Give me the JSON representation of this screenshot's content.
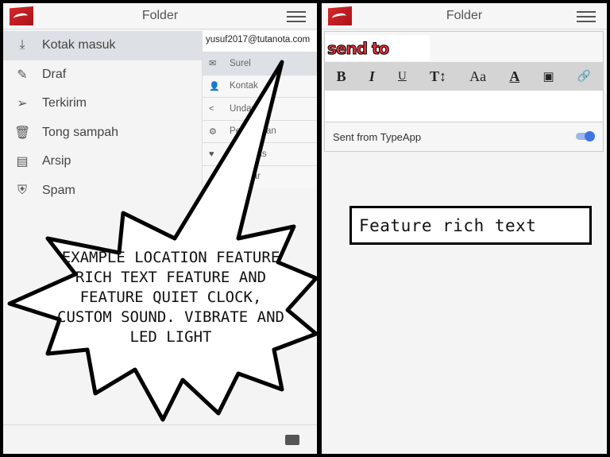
{
  "left": {
    "title": "Folder",
    "nav": [
      {
        "label": "Kotak masuk",
        "icon": "inbox-icon",
        "glyph": "⤓",
        "active": true
      },
      {
        "label": "Draf",
        "icon": "edit-icon",
        "glyph": "✎"
      },
      {
        "label": "Terkirim",
        "icon": "send-icon",
        "glyph": "➢"
      },
      {
        "label": "Tong sampah",
        "icon": "trash-icon",
        "glyph": "🗑"
      },
      {
        "label": "Arsip",
        "icon": "archive-icon",
        "glyph": "▤"
      },
      {
        "label": "Spam",
        "icon": "shield-icon",
        "glyph": "⛨"
      }
    ],
    "drawer": {
      "account": "yusuf2017@tutanota.com",
      "items": [
        {
          "label": "Surel",
          "icon": "mail-icon",
          "glyph": "✉",
          "active": true
        },
        {
          "label": "Kontak",
          "icon": "contacts-icon",
          "glyph": "👤"
        },
        {
          "label": "Undan",
          "icon": "share-icon",
          "glyph": "<"
        },
        {
          "label": "Pe          an",
          "icon": "settings-icon",
          "glyph": "⚙"
        },
        {
          "label": "         itas",
          "icon": "heart-icon",
          "glyph": "♥"
        },
        {
          "label": "         ar",
          "icon": "logout-icon",
          "glyph": ""
        }
      ]
    }
  },
  "right": {
    "title": "Folder",
    "to_label": "send to",
    "toolbar": [
      "B",
      "I",
      "U",
      "T↕",
      "Aa",
      "A",
      "▣",
      "🔗"
    ],
    "signature": "Sent from TypeApp",
    "signature_toggle": true,
    "accent": "#3f74e3"
  },
  "caption": "Feature rich text",
  "bubble": "Example location feature rich text feature and feature quiet clock, custom sound. vibrate and LED light"
}
